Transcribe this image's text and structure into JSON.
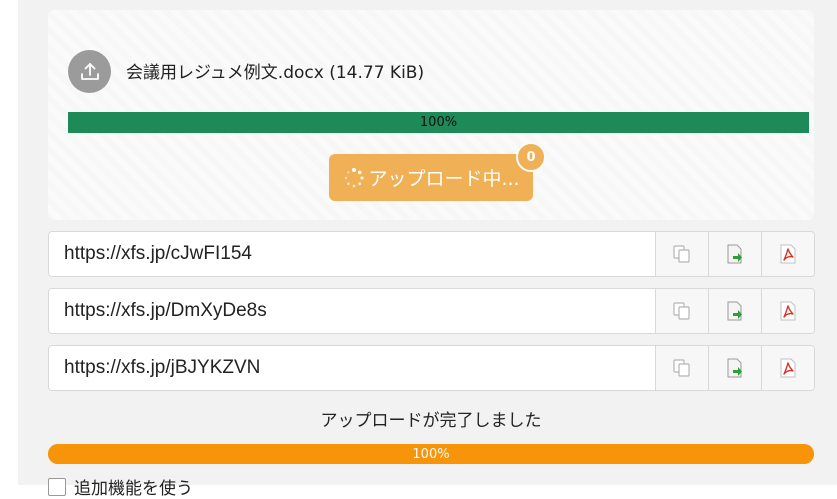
{
  "upload": {
    "file_label": "会議用レジュメ例文.docx (14.77 KiB)",
    "progress_percent": 100,
    "progress_label": "100%",
    "button_label": "アップロード中...",
    "badge_count": "0"
  },
  "links": [
    {
      "url": "https://xfs.jp/cJwFI154"
    },
    {
      "url": "https://xfs.jp/DmXyDe8s"
    },
    {
      "url": "https://xfs.jp/jBJYKZVN"
    }
  ],
  "status": {
    "message": "アップロードが完了しました",
    "progress_percent": 100,
    "progress_label": "100%"
  },
  "options": {
    "extra_features_label": "追加機能を使う"
  },
  "colors": {
    "green_bar": "#1e8a57",
    "orange_button": "#f0b055",
    "orange_bar": "#f7940a"
  }
}
